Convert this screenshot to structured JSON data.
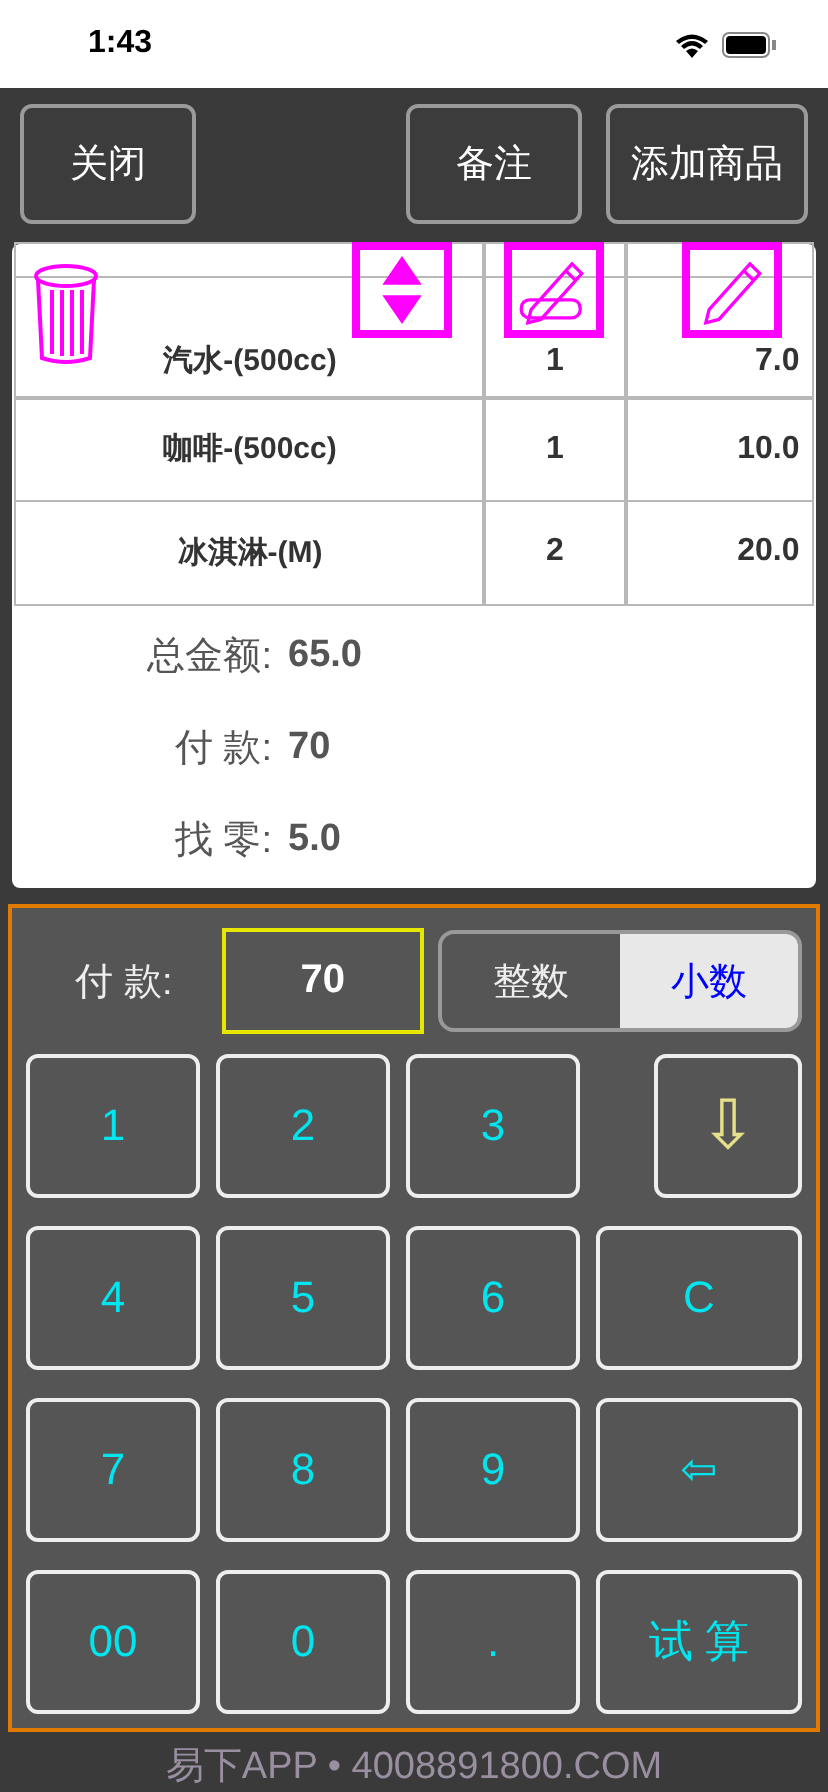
{
  "status_bar": {
    "time": "1:43"
  },
  "toolbar": {
    "buttons": [
      "关闭",
      "备注",
      "添加商品"
    ]
  },
  "order_items": [
    {
      "name": "汽水-(500cc)",
      "qty": "1",
      "price": "7.0",
      "editing": true
    },
    {
      "name": "咖啡-(500cc)",
      "qty": "1",
      "price": "10.0",
      "editing": false
    },
    {
      "name": "冰淇淋-(M)",
      "qty": "2",
      "price": "20.0",
      "editing": false
    }
  ],
  "summary": [
    {
      "label": "总金额:",
      "value": "65.0"
    },
    {
      "label": "付 款:",
      "value": "70"
    },
    {
      "label": "找 零:",
      "value": "5.0"
    }
  ],
  "payment": {
    "label": "付 款:",
    "value": "70",
    "modes": [
      {
        "label": "整数",
        "selected": false
      },
      {
        "label": "小数",
        "selected": true
      }
    ]
  },
  "keys": [
    {
      "label": "1",
      "kind": "digit"
    },
    {
      "label": "2",
      "kind": "digit"
    },
    {
      "label": "3",
      "kind": "digit"
    },
    {
      "label": "⇩",
      "kind": "down"
    },
    {
      "label": "4",
      "kind": "digit"
    },
    {
      "label": "5",
      "kind": "digit"
    },
    {
      "label": "6",
      "kind": "digit"
    },
    {
      "label": "C",
      "kind": "wide"
    },
    {
      "label": "7",
      "kind": "digit"
    },
    {
      "label": "8",
      "kind": "digit"
    },
    {
      "label": "9",
      "kind": "digit"
    },
    {
      "label": "⇦",
      "kind": "wide"
    },
    {
      "label": "00",
      "kind": "digit"
    },
    {
      "label": "0",
      "kind": "digit"
    },
    {
      "label": ".",
      "kind": "digit"
    },
    {
      "label": "试 算",
      "kind": "wide"
    }
  ],
  "footer": "易下APP • 4008891800.COM"
}
